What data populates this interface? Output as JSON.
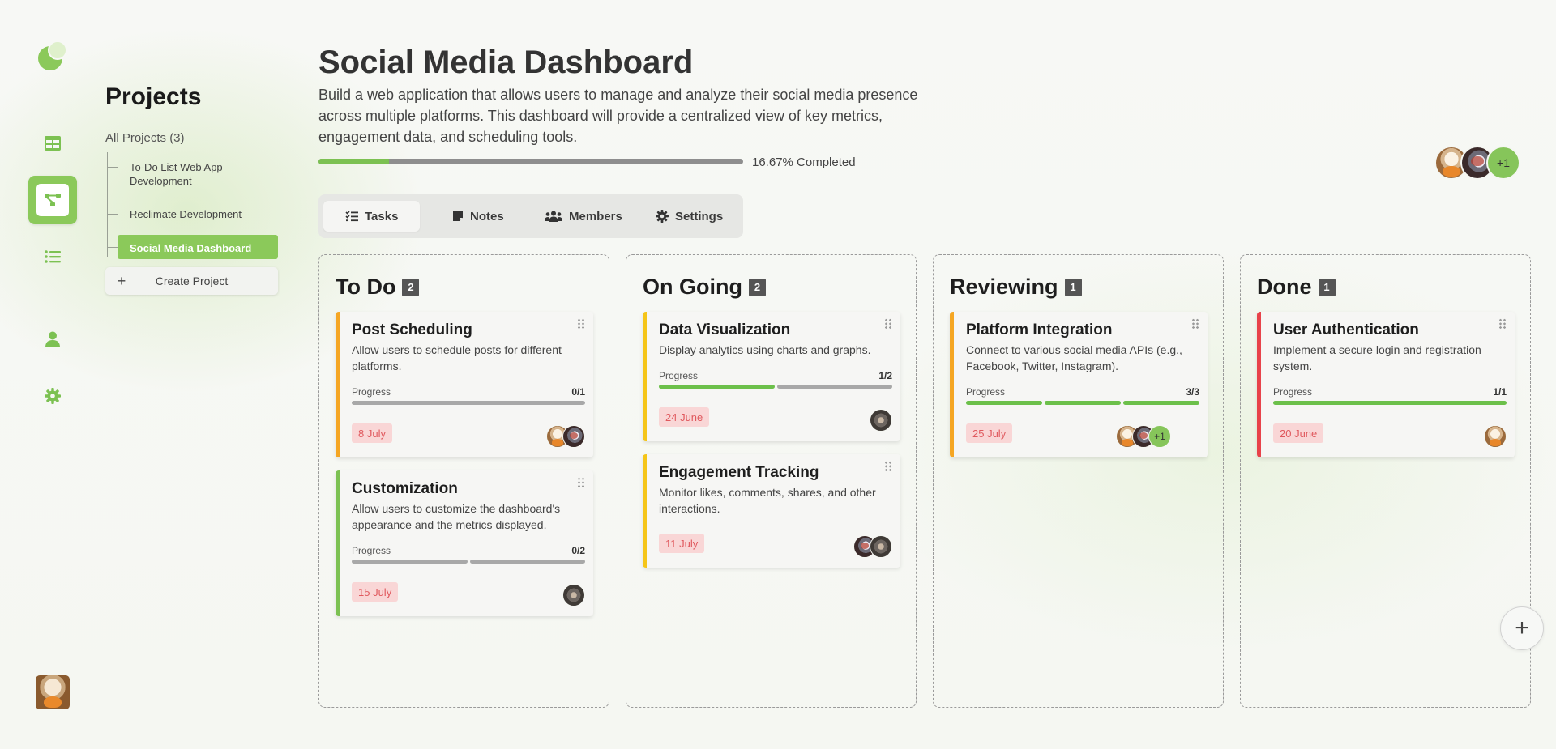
{
  "sidebar": {
    "icons": [
      "logo-icon",
      "table-icon",
      "hierarchy-icon",
      "list-icon",
      "user-icon",
      "gear-icon"
    ]
  },
  "projects": {
    "heading": "Projects",
    "all_label": "All Projects (3)",
    "items": [
      {
        "label": "To-Do List Web App Development"
      },
      {
        "label": "Reclimate Development"
      },
      {
        "label": "Social Media Dashboard"
      }
    ],
    "create_label": "Create Project",
    "create_icon": "+"
  },
  "header": {
    "title": "Social Media Dashboard",
    "description": "Build a web application that allows users to manage and analyze their social media presence across multiple platforms. This dashboard will provide a centralized view of key metrics, engagement data, and scheduling tools.",
    "progress_fraction": 0.1667,
    "progress_label": "16.67% Completed",
    "more_members": "+1"
  },
  "tabs": [
    {
      "label": "Tasks",
      "icon": "checklist-icon",
      "active": true
    },
    {
      "label": "Notes",
      "icon": "note-icon",
      "active": false
    },
    {
      "label": "Members",
      "icon": "users-icon",
      "active": false
    },
    {
      "label": "Settings",
      "icon": "gear-icon",
      "active": false
    }
  ],
  "columns": [
    {
      "title": "To Do",
      "count": "2",
      "cards": [
        {
          "title": "Post Scheduling",
          "desc": "Allow users to schedule posts for different platforms.",
          "progress_label": "Progress",
          "progress_count": "0/1",
          "done": 0,
          "total": 1,
          "date": "8 July",
          "accent": "#f5a623"
        },
        {
          "title": "Customization",
          "desc": "Allow users to customize the dashboard's appearance and the metrics displayed.",
          "progress_label": "Progress",
          "progress_count": "0/2",
          "done": 0,
          "total": 2,
          "date": "15 July",
          "accent": "#7cc152"
        }
      ]
    },
    {
      "title": "On Going",
      "count": "2",
      "cards": [
        {
          "title": "Data Visualization",
          "desc": "Display analytics using charts and graphs.",
          "progress_label": "Progress",
          "progress_count": "1/2",
          "done": 1,
          "total": 2,
          "date": "24 June",
          "accent": "#f5c518"
        },
        {
          "title": "Engagement Tracking",
          "desc": "Monitor likes, comments, shares, and other interactions.",
          "date": "11 July",
          "accent": "#f5c518"
        }
      ]
    },
    {
      "title": "Reviewing",
      "count": "1",
      "cards": [
        {
          "title": "Platform Integration",
          "desc": "Connect to various social media APIs (e.g., Facebook, Twitter, Instagram).",
          "progress_label": "Progress",
          "progress_count": "3/3",
          "done": 3,
          "total": 3,
          "date": "25 July",
          "accent": "#f5a623",
          "more": "+1"
        }
      ]
    },
    {
      "title": "Done",
      "count": "1",
      "cards": [
        {
          "title": "User Authentication",
          "desc": "Implement a secure login and registration system.",
          "progress_label": "Progress",
          "progress_count": "1/1",
          "done": 1,
          "total": 1,
          "date": "20 June",
          "accent": "#e8424a"
        }
      ]
    }
  ],
  "fab_icon": "+"
}
